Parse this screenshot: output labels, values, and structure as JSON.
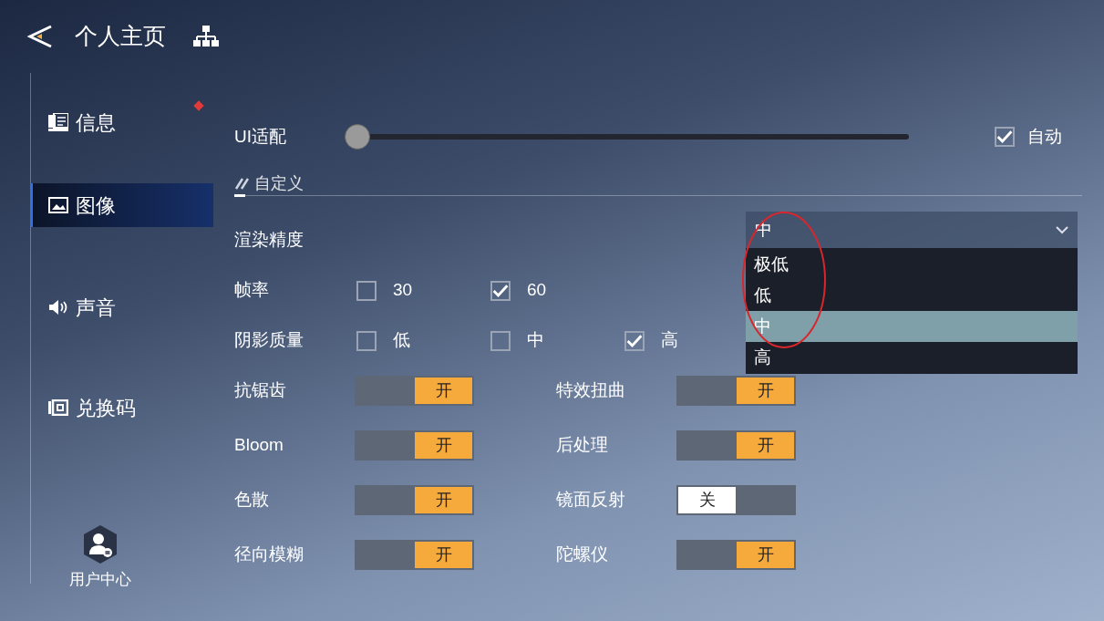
{
  "header": {
    "title": "个人主页"
  },
  "sidebar": {
    "items": [
      {
        "label": "信息",
        "selected": false,
        "badge": true
      },
      {
        "label": "图像",
        "selected": true,
        "badge": false
      },
      {
        "label": "声音",
        "selected": false,
        "badge": false
      },
      {
        "label": "兑换码",
        "selected": false,
        "badge": false
      }
    ],
    "user_center": {
      "label": "用户中心"
    }
  },
  "ui_scale": {
    "label": "UI适配",
    "level": 0,
    "auto": {
      "label": "自动",
      "checked": true
    }
  },
  "section": {
    "title": "自定义"
  },
  "render_precision": {
    "label": "渲染精度",
    "value": "中",
    "expanded": true,
    "options": [
      {
        "label": "极低",
        "selected": false
      },
      {
        "label": "低",
        "selected": false
      },
      {
        "label": "中",
        "selected": true
      },
      {
        "label": "高",
        "selected": false
      }
    ]
  },
  "option_rows": [
    {
      "label": "帧率",
      "options": [
        {
          "label": "30",
          "checked": false
        },
        {
          "label": "60",
          "checked": true
        }
      ]
    },
    {
      "label": "阴影质量",
      "options": [
        {
          "label": "低",
          "checked": false
        },
        {
          "label": "中",
          "checked": false
        },
        {
          "label": "高",
          "checked": true
        }
      ]
    }
  ],
  "toggles": [
    {
      "label": "抗锯齿",
      "on": true,
      "state_label": "开"
    },
    {
      "label": "特效扭曲",
      "on": true,
      "state_label": "开"
    },
    {
      "label": "Bloom",
      "on": true,
      "state_label": "开"
    },
    {
      "label": "后处理",
      "on": true,
      "state_label": "开"
    },
    {
      "label": "色散",
      "on": true,
      "state_label": "开"
    },
    {
      "label": "镜面反射",
      "on": false,
      "state_label": "关"
    },
    {
      "label": "径向模糊",
      "on": true,
      "state_label": "开"
    },
    {
      "label": "陀螺仪",
      "on": true,
      "state_label": "开"
    }
  ]
}
